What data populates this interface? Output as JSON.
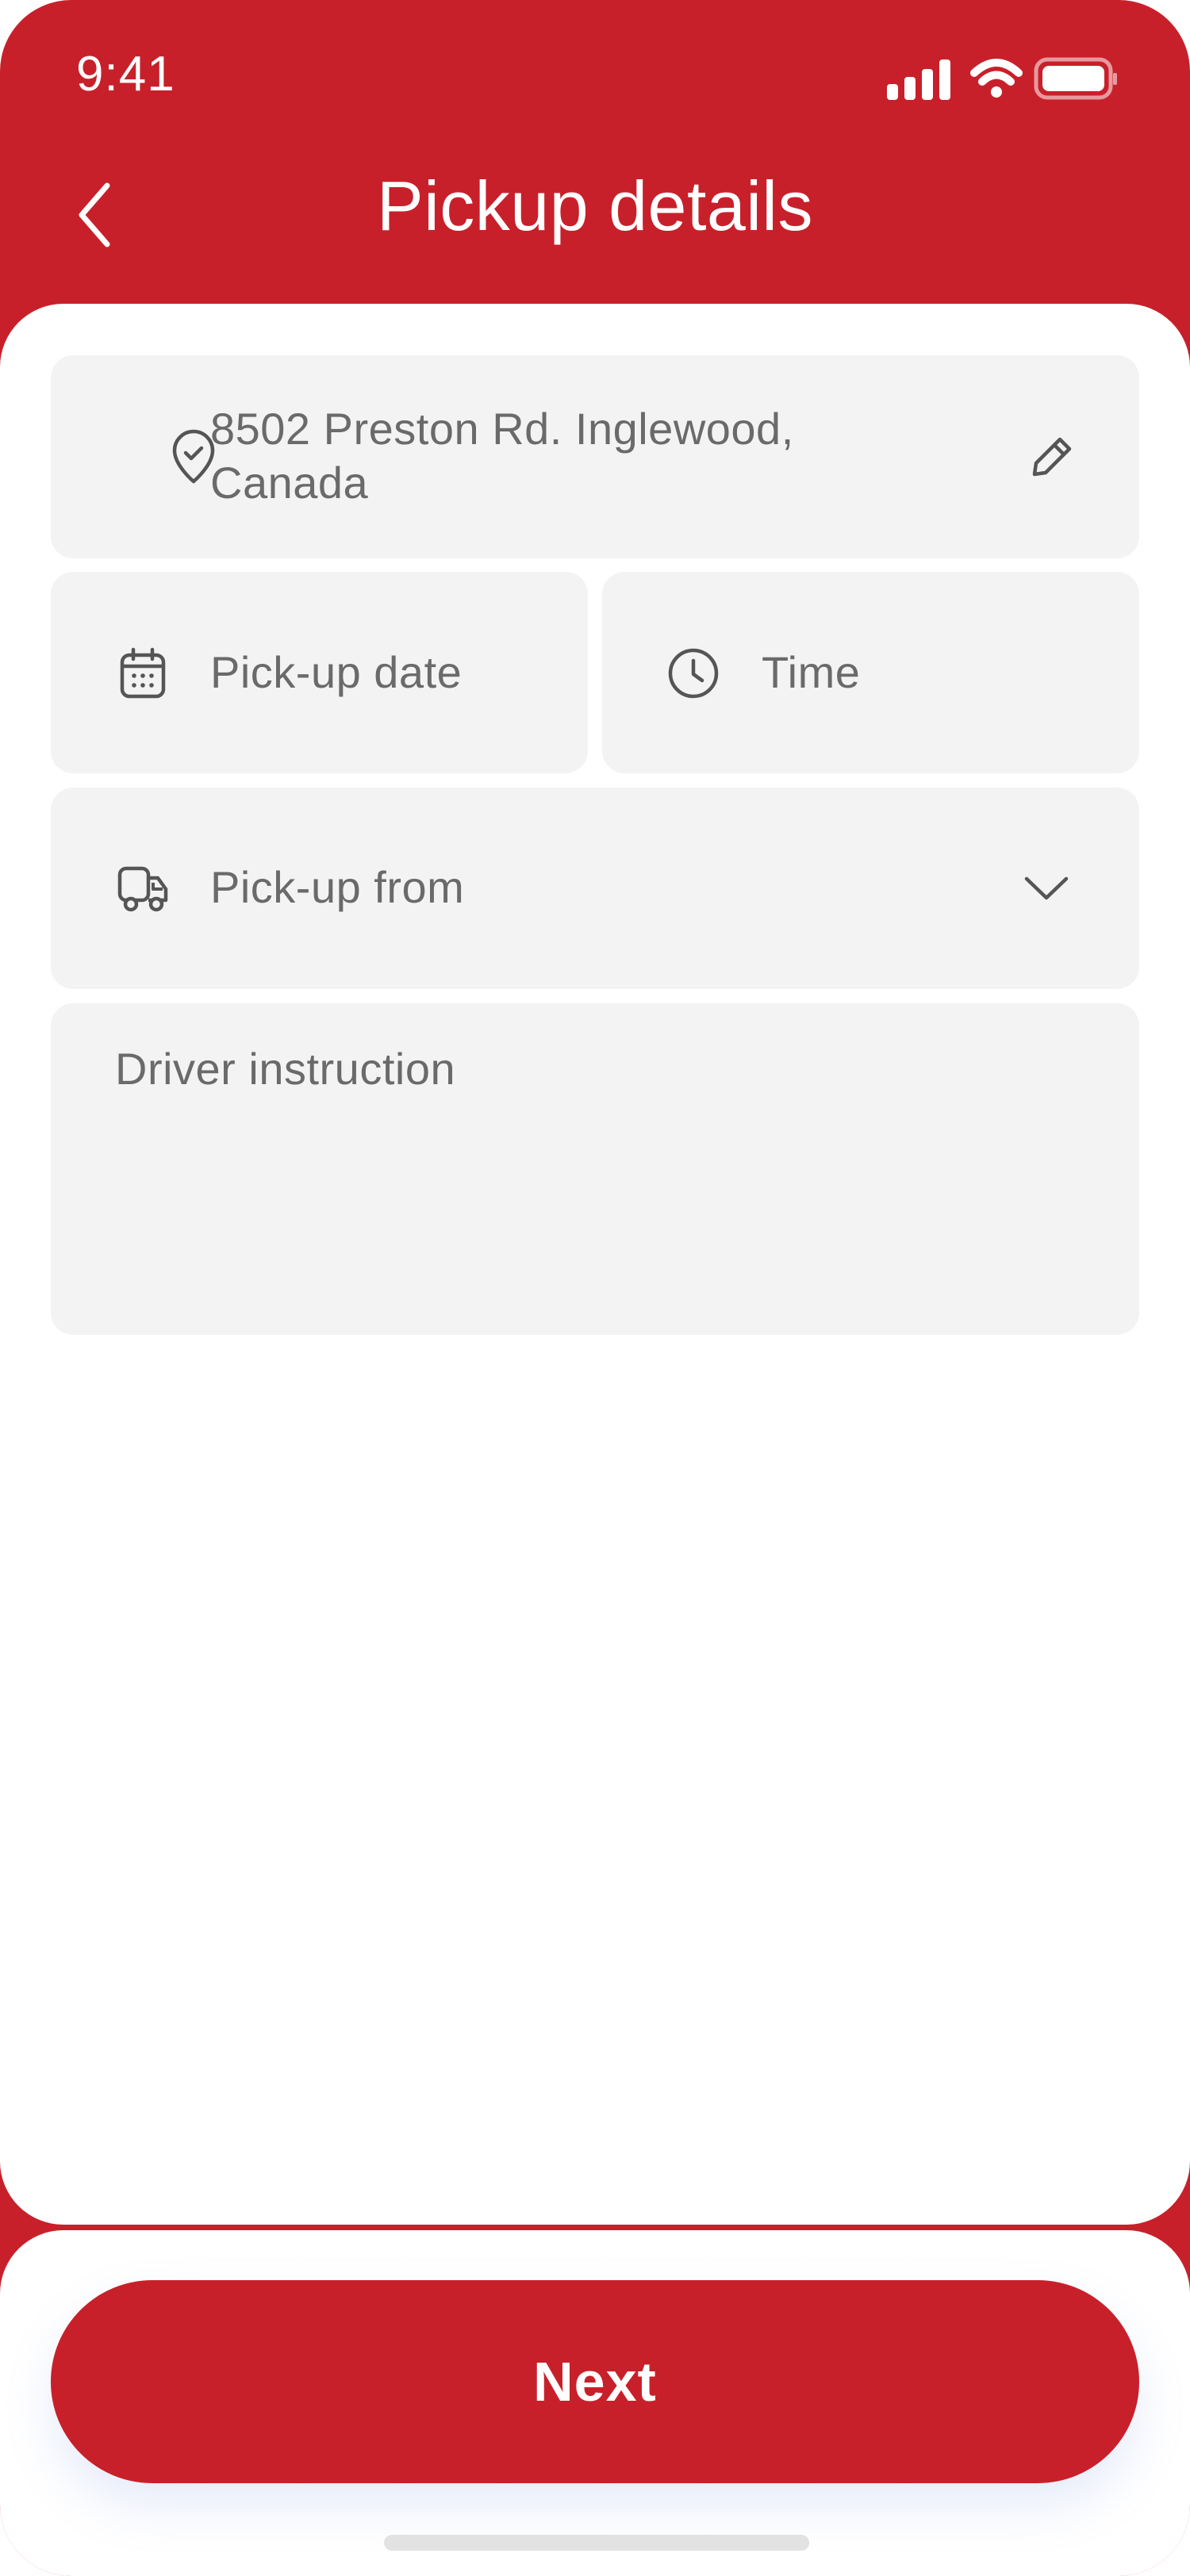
{
  "status_bar": {
    "time": "9:41",
    "icons": [
      "signal-icon",
      "wifi-icon",
      "battery-icon"
    ]
  },
  "header": {
    "title": "Pickup details",
    "back_icon": "chevron-left-icon"
  },
  "form": {
    "address": {
      "line1": "8502 Preston Rd. Inglewood,",
      "line2": "Canada",
      "icon": "location-check-icon",
      "edit_icon": "pencil-icon"
    },
    "pickup_date": {
      "placeholder": "Pick-up date",
      "icon": "calendar-icon"
    },
    "time": {
      "placeholder": "Time",
      "icon": "clock-icon"
    },
    "pickup_from": {
      "placeholder": "Pick-up from",
      "icon": "truck-icon",
      "dropdown_icon": "chevron-down-icon"
    },
    "driver_instruction": {
      "placeholder": "Driver instruction"
    }
  },
  "actions": {
    "next_label": "Next"
  },
  "colors": {
    "brand_red": "#C8202A",
    "field_bg": "#F3F3F3",
    "placeholder_text": "#6A6A6A",
    "white": "#FFFFFF"
  }
}
